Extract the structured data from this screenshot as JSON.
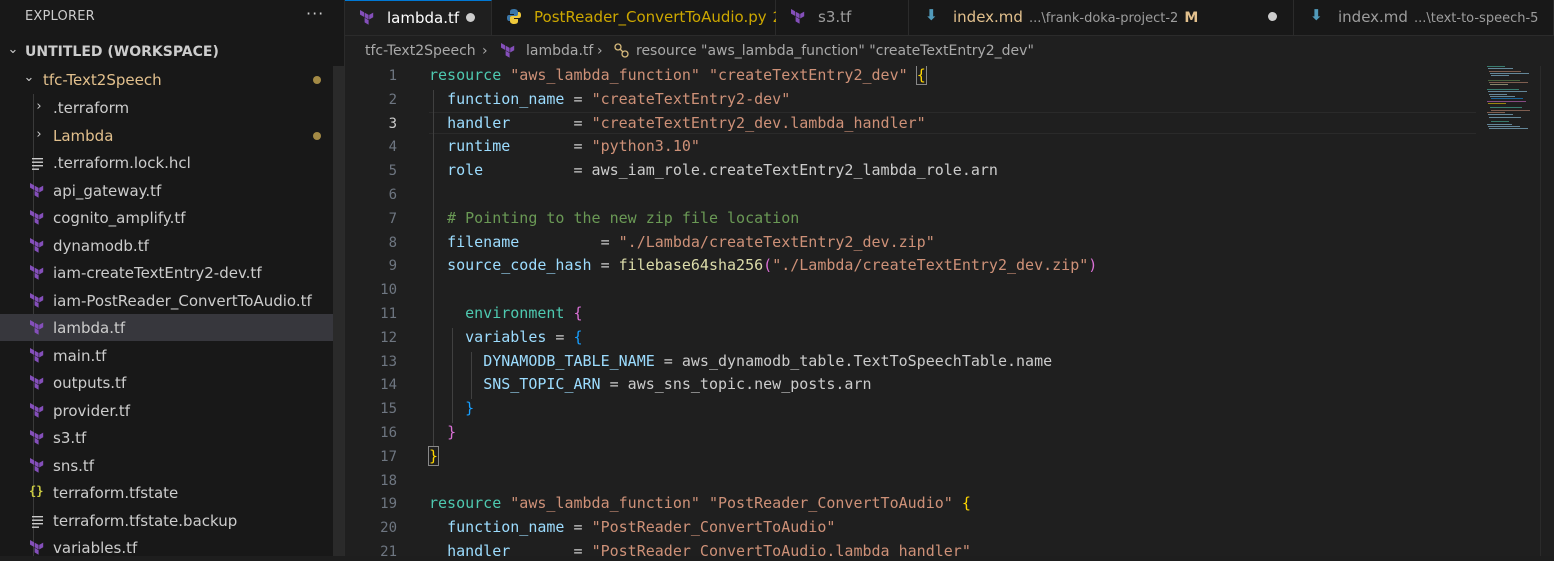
{
  "explorer": {
    "title": "EXPLORER",
    "more": "···",
    "workspace": "UNTITLED (WORKSPACE)",
    "folder": "tfc-Text2Speech",
    "items": [
      {
        "label": ".terraform",
        "kind": "folder"
      },
      {
        "label": "Lambda",
        "kind": "folder",
        "modified": true
      },
      {
        "label": ".terraform.lock.hcl",
        "kind": "lines"
      },
      {
        "label": "api_gateway.tf",
        "kind": "terraform"
      },
      {
        "label": "cognito_amplify.tf",
        "kind": "terraform"
      },
      {
        "label": "dynamodb.tf",
        "kind": "terraform"
      },
      {
        "label": "iam-createTextEntry2-dev.tf",
        "kind": "terraform"
      },
      {
        "label": "iam-PostReader_ConvertToAudio.tf",
        "kind": "terraform"
      },
      {
        "label": "lambda.tf",
        "kind": "terraform",
        "selected": true
      },
      {
        "label": "main.tf",
        "kind": "terraform"
      },
      {
        "label": "outputs.tf",
        "kind": "terraform"
      },
      {
        "label": "provider.tf",
        "kind": "terraform"
      },
      {
        "label": "s3.tf",
        "kind": "terraform"
      },
      {
        "label": "sns.tf",
        "kind": "terraform"
      },
      {
        "label": "terraform.tfstate",
        "kind": "json"
      },
      {
        "label": "terraform.tfstate.backup",
        "kind": "lines"
      },
      {
        "label": "variables.tf",
        "kind": "terraform"
      }
    ]
  },
  "tabs": [
    {
      "label": "lambda.tf",
      "active": true,
      "dirty": true
    },
    {
      "label": "PostReader_ConvertToAudio.py",
      "badge": "2",
      "warning": true
    },
    {
      "label": "s3.tf"
    },
    {
      "label": "index.md",
      "description": "...\\frank-doka-project-2",
      "badge": "M",
      "dirty": true
    },
    {
      "label": "index.md",
      "description": "...\\text-to-speech-5"
    }
  ],
  "breadcrumb": {
    "folder": "tfc-Text2Speech",
    "file": "lambda.tf",
    "symbol": "resource \"aws_lambda_function\" \"createTextEntry2_dev\""
  },
  "editor": {
    "current_line": 3,
    "line_numbers": [
      "1",
      "2",
      "3",
      "4",
      "5",
      "6",
      "7",
      "8",
      "9",
      "10",
      "11",
      "12",
      "13",
      "14",
      "15",
      "16",
      "17",
      "18",
      "19",
      "20",
      "21"
    ],
    "lines": [
      "resource \"aws_lambda_function\" \"createTextEntry2_dev\" {",
      "  function_name = \"createTextEntry2-dev\"",
      "  handler       = \"createTextEntry2_dev.lambda_handler\"",
      "  runtime       = \"python3.10\"",
      "  role          = aws_iam_role.createTextEntry2_lambda_role.arn",
      "",
      "  # Pointing to the new zip file location",
      "  filename         = \"./Lambda/createTextEntry2_dev.zip\"",
      "  source_code_hash = filebase64sha256(\"./Lambda/createTextEntry2_dev.zip\")",
      "",
      "    environment {",
      "    variables = {",
      "      DYNAMODB_TABLE_NAME = aws_dynamodb_table.TextToSpeechTable.name",
      "      SNS_TOPIC_ARN = aws_sns_topic.new_posts.arn",
      "    }",
      "  }",
      "}",
      "",
      "resource \"aws_lambda_function\" \"PostReader_ConvertToAudio\" {",
      "  function_name = \"PostReader_ConvertToAudio\"",
      "  handler       = \"PostReader_ConvertToAudio.lambda_handler\""
    ]
  },
  "colors": {
    "keyword": "#4ec9b0",
    "string": "#ce9178",
    "attribute": "#9cdcfe",
    "function": "#dcdcaa",
    "comment": "#6a9955",
    "modified": "#e2c08d",
    "terraform_icon": "#844fba",
    "accent": "#0078d4"
  }
}
